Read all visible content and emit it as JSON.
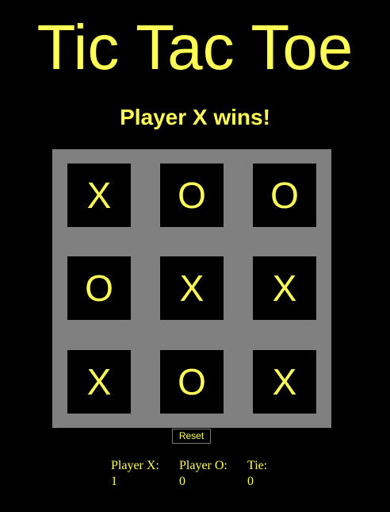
{
  "title": "Tic Tac Toe",
  "status": "Player X wins!",
  "board": {
    "cells": [
      "X",
      "O",
      "O",
      "O",
      "X",
      "X",
      "X",
      "O",
      "X"
    ]
  },
  "reset_label": "Reset",
  "scores": [
    {
      "label": "Player X:",
      "value": "1"
    },
    {
      "label": "Player O:",
      "value": "0"
    },
    {
      "label": "Tie:",
      "value": "0"
    }
  ],
  "colors": {
    "background": "#000000",
    "text": "#FFFF55",
    "board": "#808080",
    "cell": "#000000"
  }
}
